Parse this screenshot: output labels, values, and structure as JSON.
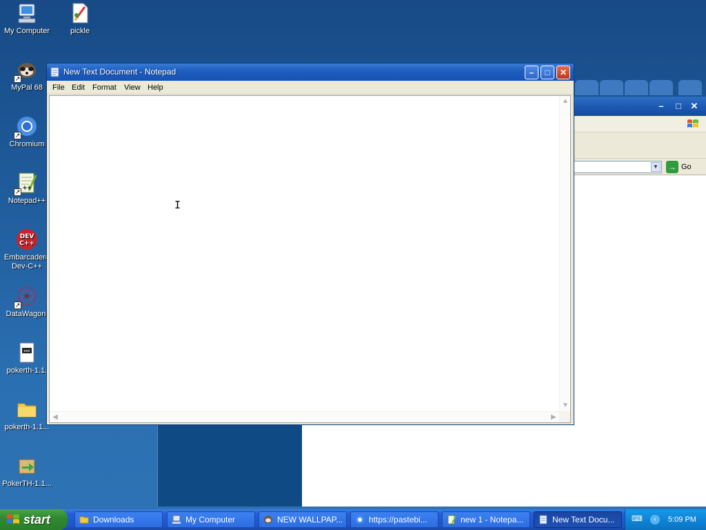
{
  "desktop": {
    "icons": [
      {
        "label": "My Computer",
        "icon": "my-computer-icon"
      },
      {
        "label": "pickle",
        "icon": "paint-file-icon"
      },
      {
        "label": "MyPal 68",
        "icon": "mypal-raccoon-icon"
      },
      {
        "label": "Chromium",
        "icon": "chromium-icon"
      },
      {
        "label": "Notepad++",
        "icon": "notepadpp-icon"
      },
      {
        "label": "Embarcadero",
        "label2": "Dev-C++",
        "icon": "devcpp-icon"
      },
      {
        "label": "DataWagon.",
        "icon": "datawagon-icon"
      },
      {
        "label": "pokerth-1.1.",
        "icon": "installer-file-icon"
      },
      {
        "label": "pokerth-1.1...",
        "icon": "folder-icon"
      },
      {
        "label": "PokerTH-1.1...",
        "icon": "pokerth-package-icon"
      }
    ]
  },
  "notepad": {
    "title": "New Text Document - Notepad",
    "menu": [
      "File",
      "Edit",
      "Format",
      "View",
      "Help"
    ],
    "content": ""
  },
  "background_browser": {
    "go_label": "Go"
  },
  "taskbar": {
    "start_label": "start",
    "items": [
      {
        "label": "Downloads",
        "icon": "folder-icon",
        "active": false
      },
      {
        "label": "My Computer",
        "icon": "my-computer-icon",
        "active": false
      },
      {
        "label": "NEW WALLPAP...",
        "icon": "mypal-raccoon-icon",
        "active": false
      },
      {
        "label": "https://pastebi...",
        "icon": "chromium-icon",
        "active": false
      },
      {
        "label": "new 1 - Notepa...",
        "icon": "notepadpp-icon",
        "active": false
      },
      {
        "label": "New Text Docu...",
        "icon": "notepad-icon",
        "active": true
      }
    ],
    "clock": "5:09 PM"
  },
  "colors": {
    "desktop_bg": "#1f5b9b",
    "title_bar": "#1f5fbf",
    "taskbar": "#245edb",
    "start_green": "#2f8b2f",
    "tray": "#0f85d8"
  }
}
